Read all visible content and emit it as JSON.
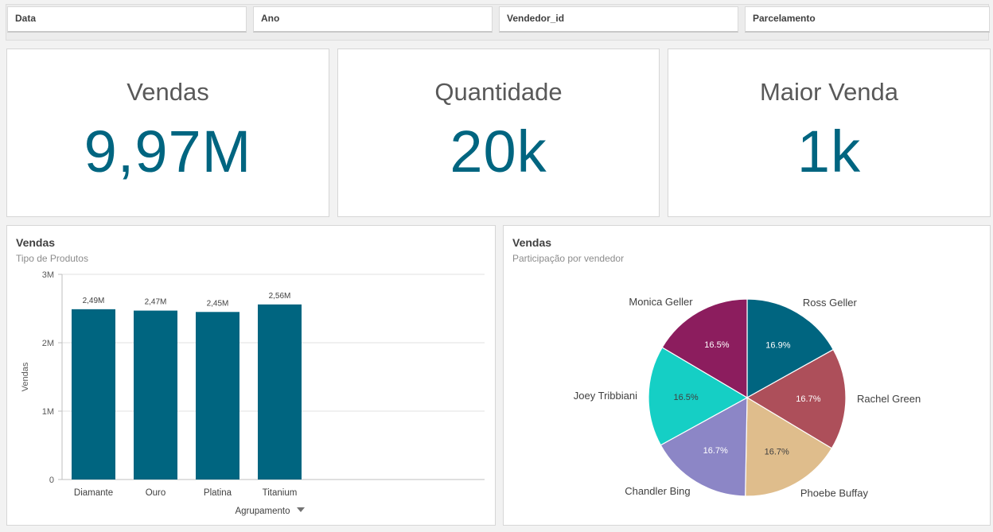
{
  "filters": [
    "Data",
    "Ano",
    "Vendedor_id",
    "Parcelamento"
  ],
  "kpis": [
    {
      "title": "Vendas",
      "value": "9,97M"
    },
    {
      "title": "Quantidade",
      "value": "20k"
    },
    {
      "title": "Maior Venda",
      "value": "1k"
    }
  ],
  "colors": {
    "accent": "#006580",
    "gridline": "#e0e0e0"
  },
  "bar_chart": {
    "title": "Vendas",
    "subtitle": "Tipo de Produtos",
    "dropdown_icon": "caret-down-icon"
  },
  "pie_chart": {
    "title": "Vendas",
    "subtitle": "Participação por vendedor"
  },
  "chart_data": [
    {
      "type": "bar",
      "title": "Vendas",
      "subtitle": "Tipo de Produtos",
      "xlabel": "Agrupamento",
      "ylabel": "Vendas",
      "categories": [
        "Diamante",
        "Ouro",
        "Platina",
        "Titanium"
      ],
      "values": [
        2.49,
        2.47,
        2.45,
        2.56
      ],
      "value_labels": [
        "2,49M",
        "2,47M",
        "2,45M",
        "2,56M"
      ],
      "yticks": [
        0,
        1,
        2,
        3
      ],
      "ytick_labels": [
        "0",
        "1M",
        "2M",
        "3M"
      ],
      "ylim": [
        0,
        3
      ],
      "grid": true,
      "color": "#006580"
    },
    {
      "type": "pie",
      "title": "Vendas",
      "subtitle": "Participação por vendedor",
      "slices": [
        {
          "label": "Ross Geller",
          "value": 16.9,
          "pct": "16.9%",
          "color": "#006580"
        },
        {
          "label": "Rachel Green",
          "value": 16.7,
          "pct": "16.7%",
          "color": "#ad4f5a"
        },
        {
          "label": "Phoebe Buffay",
          "value": 16.7,
          "pct": "16.7%",
          "color": "#dfbd8c"
        },
        {
          "label": "Chandler Bing",
          "value": 16.7,
          "pct": "16.7%",
          "color": "#8c86c6"
        },
        {
          "label": "Joey Tribbiani",
          "value": 16.5,
          "pct": "16.5%",
          "color": "#15cfc5"
        },
        {
          "label": "Monica Geller",
          "value": 16.5,
          "pct": "16.5%",
          "color": "#8c1d5e"
        }
      ]
    }
  ]
}
